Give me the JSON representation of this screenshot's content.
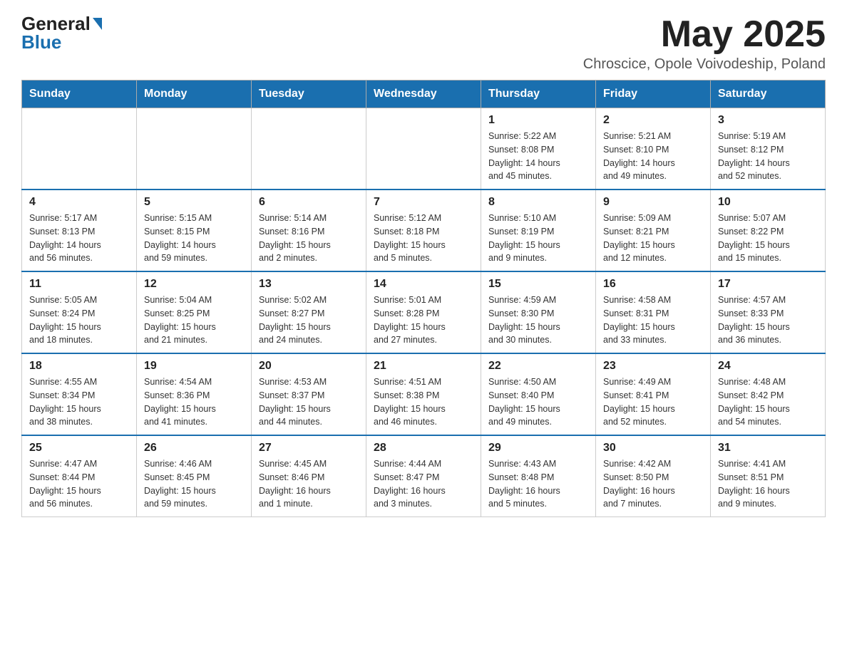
{
  "header": {
    "logo_general": "General",
    "logo_blue": "Blue",
    "title": "May 2025",
    "subtitle": "Chroscice, Opole Voivodeship, Poland"
  },
  "days_of_week": [
    "Sunday",
    "Monday",
    "Tuesday",
    "Wednesday",
    "Thursday",
    "Friday",
    "Saturday"
  ],
  "weeks": [
    [
      {
        "day": "",
        "info": ""
      },
      {
        "day": "",
        "info": ""
      },
      {
        "day": "",
        "info": ""
      },
      {
        "day": "",
        "info": ""
      },
      {
        "day": "1",
        "info": "Sunrise: 5:22 AM\nSunset: 8:08 PM\nDaylight: 14 hours\nand 45 minutes."
      },
      {
        "day": "2",
        "info": "Sunrise: 5:21 AM\nSunset: 8:10 PM\nDaylight: 14 hours\nand 49 minutes."
      },
      {
        "day": "3",
        "info": "Sunrise: 5:19 AM\nSunset: 8:12 PM\nDaylight: 14 hours\nand 52 minutes."
      }
    ],
    [
      {
        "day": "4",
        "info": "Sunrise: 5:17 AM\nSunset: 8:13 PM\nDaylight: 14 hours\nand 56 minutes."
      },
      {
        "day": "5",
        "info": "Sunrise: 5:15 AM\nSunset: 8:15 PM\nDaylight: 14 hours\nand 59 minutes."
      },
      {
        "day": "6",
        "info": "Sunrise: 5:14 AM\nSunset: 8:16 PM\nDaylight: 15 hours\nand 2 minutes."
      },
      {
        "day": "7",
        "info": "Sunrise: 5:12 AM\nSunset: 8:18 PM\nDaylight: 15 hours\nand 5 minutes."
      },
      {
        "day": "8",
        "info": "Sunrise: 5:10 AM\nSunset: 8:19 PM\nDaylight: 15 hours\nand 9 minutes."
      },
      {
        "day": "9",
        "info": "Sunrise: 5:09 AM\nSunset: 8:21 PM\nDaylight: 15 hours\nand 12 minutes."
      },
      {
        "day": "10",
        "info": "Sunrise: 5:07 AM\nSunset: 8:22 PM\nDaylight: 15 hours\nand 15 minutes."
      }
    ],
    [
      {
        "day": "11",
        "info": "Sunrise: 5:05 AM\nSunset: 8:24 PM\nDaylight: 15 hours\nand 18 minutes."
      },
      {
        "day": "12",
        "info": "Sunrise: 5:04 AM\nSunset: 8:25 PM\nDaylight: 15 hours\nand 21 minutes."
      },
      {
        "day": "13",
        "info": "Sunrise: 5:02 AM\nSunset: 8:27 PM\nDaylight: 15 hours\nand 24 minutes."
      },
      {
        "day": "14",
        "info": "Sunrise: 5:01 AM\nSunset: 8:28 PM\nDaylight: 15 hours\nand 27 minutes."
      },
      {
        "day": "15",
        "info": "Sunrise: 4:59 AM\nSunset: 8:30 PM\nDaylight: 15 hours\nand 30 minutes."
      },
      {
        "day": "16",
        "info": "Sunrise: 4:58 AM\nSunset: 8:31 PM\nDaylight: 15 hours\nand 33 minutes."
      },
      {
        "day": "17",
        "info": "Sunrise: 4:57 AM\nSunset: 8:33 PM\nDaylight: 15 hours\nand 36 minutes."
      }
    ],
    [
      {
        "day": "18",
        "info": "Sunrise: 4:55 AM\nSunset: 8:34 PM\nDaylight: 15 hours\nand 38 minutes."
      },
      {
        "day": "19",
        "info": "Sunrise: 4:54 AM\nSunset: 8:36 PM\nDaylight: 15 hours\nand 41 minutes."
      },
      {
        "day": "20",
        "info": "Sunrise: 4:53 AM\nSunset: 8:37 PM\nDaylight: 15 hours\nand 44 minutes."
      },
      {
        "day": "21",
        "info": "Sunrise: 4:51 AM\nSunset: 8:38 PM\nDaylight: 15 hours\nand 46 minutes."
      },
      {
        "day": "22",
        "info": "Sunrise: 4:50 AM\nSunset: 8:40 PM\nDaylight: 15 hours\nand 49 minutes."
      },
      {
        "day": "23",
        "info": "Sunrise: 4:49 AM\nSunset: 8:41 PM\nDaylight: 15 hours\nand 52 minutes."
      },
      {
        "day": "24",
        "info": "Sunrise: 4:48 AM\nSunset: 8:42 PM\nDaylight: 15 hours\nand 54 minutes."
      }
    ],
    [
      {
        "day": "25",
        "info": "Sunrise: 4:47 AM\nSunset: 8:44 PM\nDaylight: 15 hours\nand 56 minutes."
      },
      {
        "day": "26",
        "info": "Sunrise: 4:46 AM\nSunset: 8:45 PM\nDaylight: 15 hours\nand 59 minutes."
      },
      {
        "day": "27",
        "info": "Sunrise: 4:45 AM\nSunset: 8:46 PM\nDaylight: 16 hours\nand 1 minute."
      },
      {
        "day": "28",
        "info": "Sunrise: 4:44 AM\nSunset: 8:47 PM\nDaylight: 16 hours\nand 3 minutes."
      },
      {
        "day": "29",
        "info": "Sunrise: 4:43 AM\nSunset: 8:48 PM\nDaylight: 16 hours\nand 5 minutes."
      },
      {
        "day": "30",
        "info": "Sunrise: 4:42 AM\nSunset: 8:50 PM\nDaylight: 16 hours\nand 7 minutes."
      },
      {
        "day": "31",
        "info": "Sunrise: 4:41 AM\nSunset: 8:51 PM\nDaylight: 16 hours\nand 9 minutes."
      }
    ]
  ]
}
